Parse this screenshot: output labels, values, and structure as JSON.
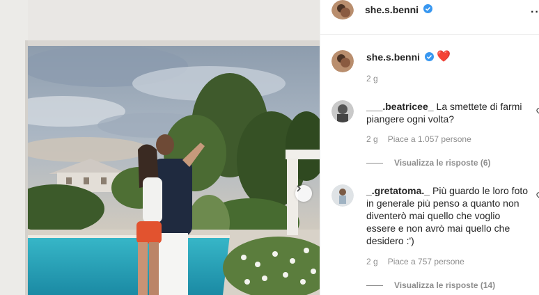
{
  "post": {
    "username": "she.s.benni",
    "icons": {
      "verified": "verified-badge-icon",
      "next": "chevron-right-icon",
      "more": "more-options-icon",
      "heart": "red-heart-emoji"
    }
  },
  "caption": {
    "username": "she.s.benni",
    "emoji": "❤️",
    "time": "2 g"
  },
  "comments": [
    {
      "username": "___.beatricee_",
      "text": "La smettete di farmi piangere ogni volta?",
      "time": "2 g",
      "likes": "Piace a 1.057 persone",
      "replies": "Visualizza le risposte (6)"
    },
    {
      "username": "_.gretatoma._",
      "text": "Più guardo le loro foto in generale più penso a quanto non diventerò mai quello che voglio essere e non avrò mai quello che desidero :')",
      "time": "2 g",
      "likes": "Piace a 757 persone",
      "replies": "Visualizza le risposte (14)"
    }
  ],
  "colors": {
    "verified": "#3897f0",
    "heart": "#ed4956",
    "muted": "#8e8e8e",
    "text": "#262626"
  }
}
